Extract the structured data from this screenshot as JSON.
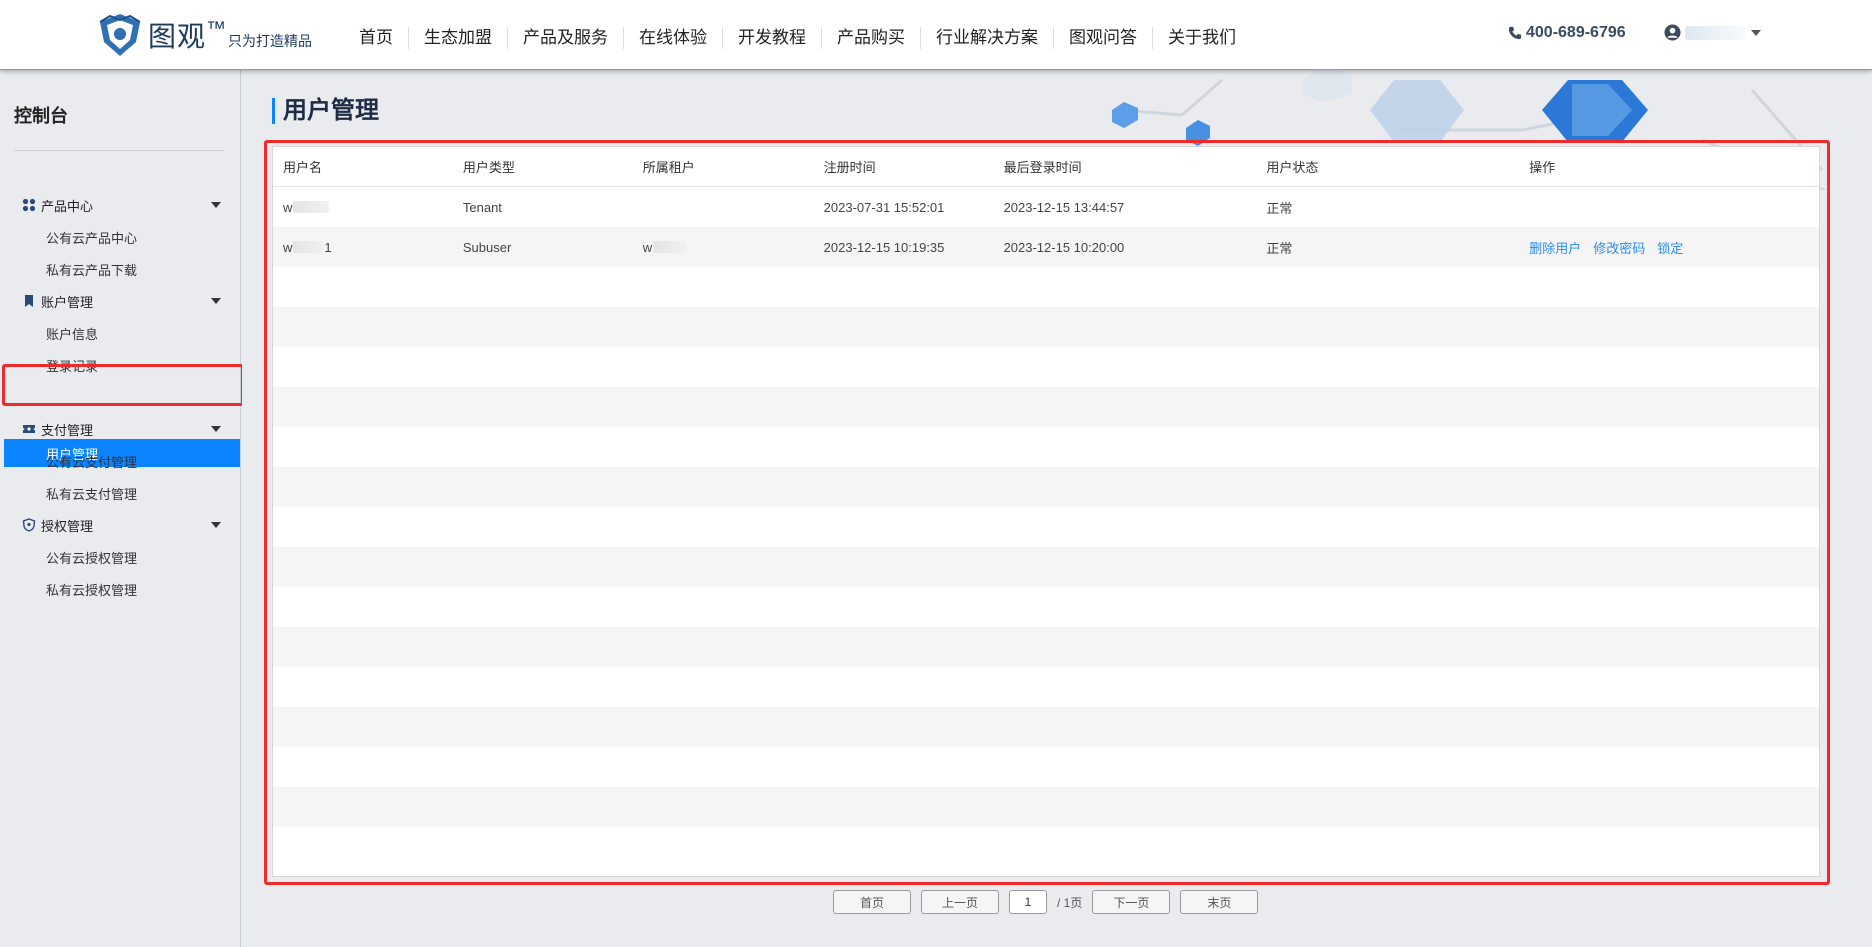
{
  "header": {
    "brand": "图观",
    "trademark": "™",
    "slogan": "只为打造精品",
    "nav": [
      "首页",
      "生态加盟",
      "产品及服务",
      "在线体验",
      "开发教程",
      "产品购买",
      "行业解决方案",
      "图观问答",
      "关于我们"
    ],
    "phone": "400-689-6796"
  },
  "sidebar": {
    "title": "控制台",
    "groups": [
      {
        "label": "产品中心",
        "icon": "grid-icon",
        "items": [
          "公有云产品中心",
          "私有云产品下载"
        ]
      },
      {
        "label": "账户管理",
        "icon": "bookmark-icon",
        "items": [
          "账户信息",
          "登录记录",
          "用户管理"
        ]
      },
      {
        "label": "支付管理",
        "icon": "ticket-icon",
        "items": [
          "公有云支付管理",
          "私有云支付管理"
        ]
      },
      {
        "label": "授权管理",
        "icon": "shield-icon",
        "items": [
          "公有云授权管理",
          "私有云授权管理"
        ]
      }
    ],
    "active_item": "用户管理"
  },
  "main": {
    "title": "用户管理",
    "columns": [
      "用户名",
      "用户类型",
      "所属租户",
      "注册时间",
      "最后登录时间",
      "用户状态",
      "操作"
    ],
    "rows": [
      {
        "username": "w",
        "type": "Tenant",
        "tenant": "",
        "registered": "2023-07-31 15:52:01",
        "last_login": "2023-12-15 13:44:57",
        "status": "正常",
        "actions": []
      },
      {
        "username": "w 1",
        "type": "Subuser",
        "tenant": "w",
        "registered": "2023-12-15 10:19:35",
        "last_login": "2023-12-15 10:20:00",
        "status": "正常",
        "actions": [
          "删除用户",
          "修改密码",
          "锁定"
        ]
      }
    ]
  },
  "pagination": {
    "first": "首页",
    "prev": "上一页",
    "current": "1",
    "total": "/ 1页",
    "next": "下一页",
    "last": "末页"
  },
  "colors": {
    "accent": "#0a84ff",
    "link": "#2b8cf0",
    "highlight": "#ee2b2b"
  }
}
